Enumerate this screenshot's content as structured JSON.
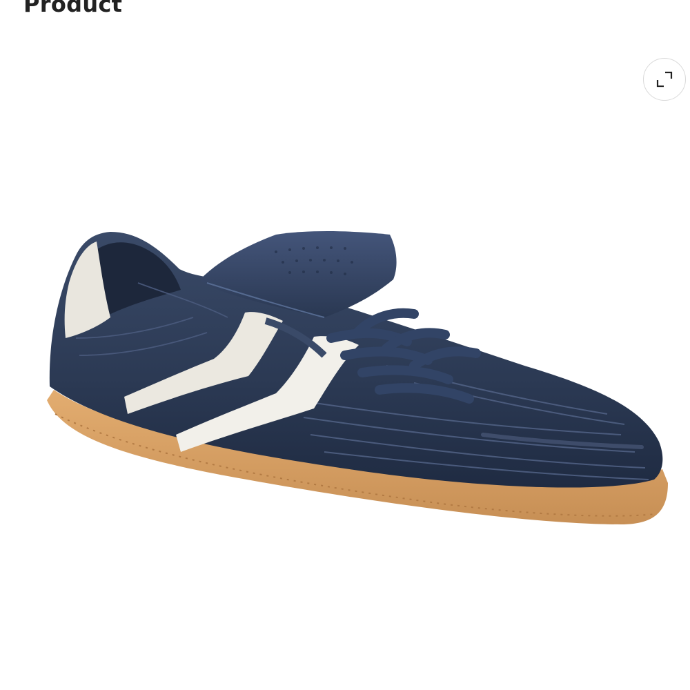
{
  "header": {
    "title": "Product"
  },
  "gallery": {
    "expand_icon": "expand-icon",
    "image": {
      "subject": "sneaker",
      "colors": {
        "upper": "#2c3a55",
        "upper_dark": "#1e2a40",
        "stripe": "#ebe9e2",
        "sole": "#d8a165",
        "sole_dark": "#b8834d",
        "lace": "#33456a"
      }
    }
  }
}
